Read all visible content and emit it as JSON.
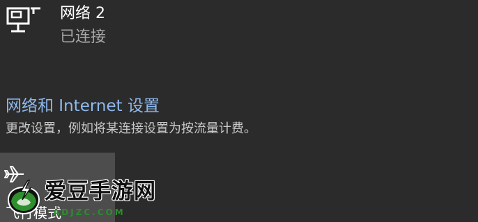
{
  "network": {
    "name": "网络 2",
    "status": "已连接",
    "icon": "ethernet-monitor-icon"
  },
  "settings": {
    "link_label": "网络和 Internet 设置",
    "description": "更改设置，例如将某连接设置为按流量计费。"
  },
  "quick_actions": [
    {
      "label": "飞行模式",
      "icon": "airplane-icon",
      "active": false
    }
  ],
  "watermark": {
    "title": "爱豆手游网",
    "url": "ADJZC.COM"
  },
  "colors": {
    "background": "#2b2b2b",
    "link": "#8fb9ee",
    "tile": "#4d4d4d",
    "watermark_accent": "#2a8f2a"
  }
}
